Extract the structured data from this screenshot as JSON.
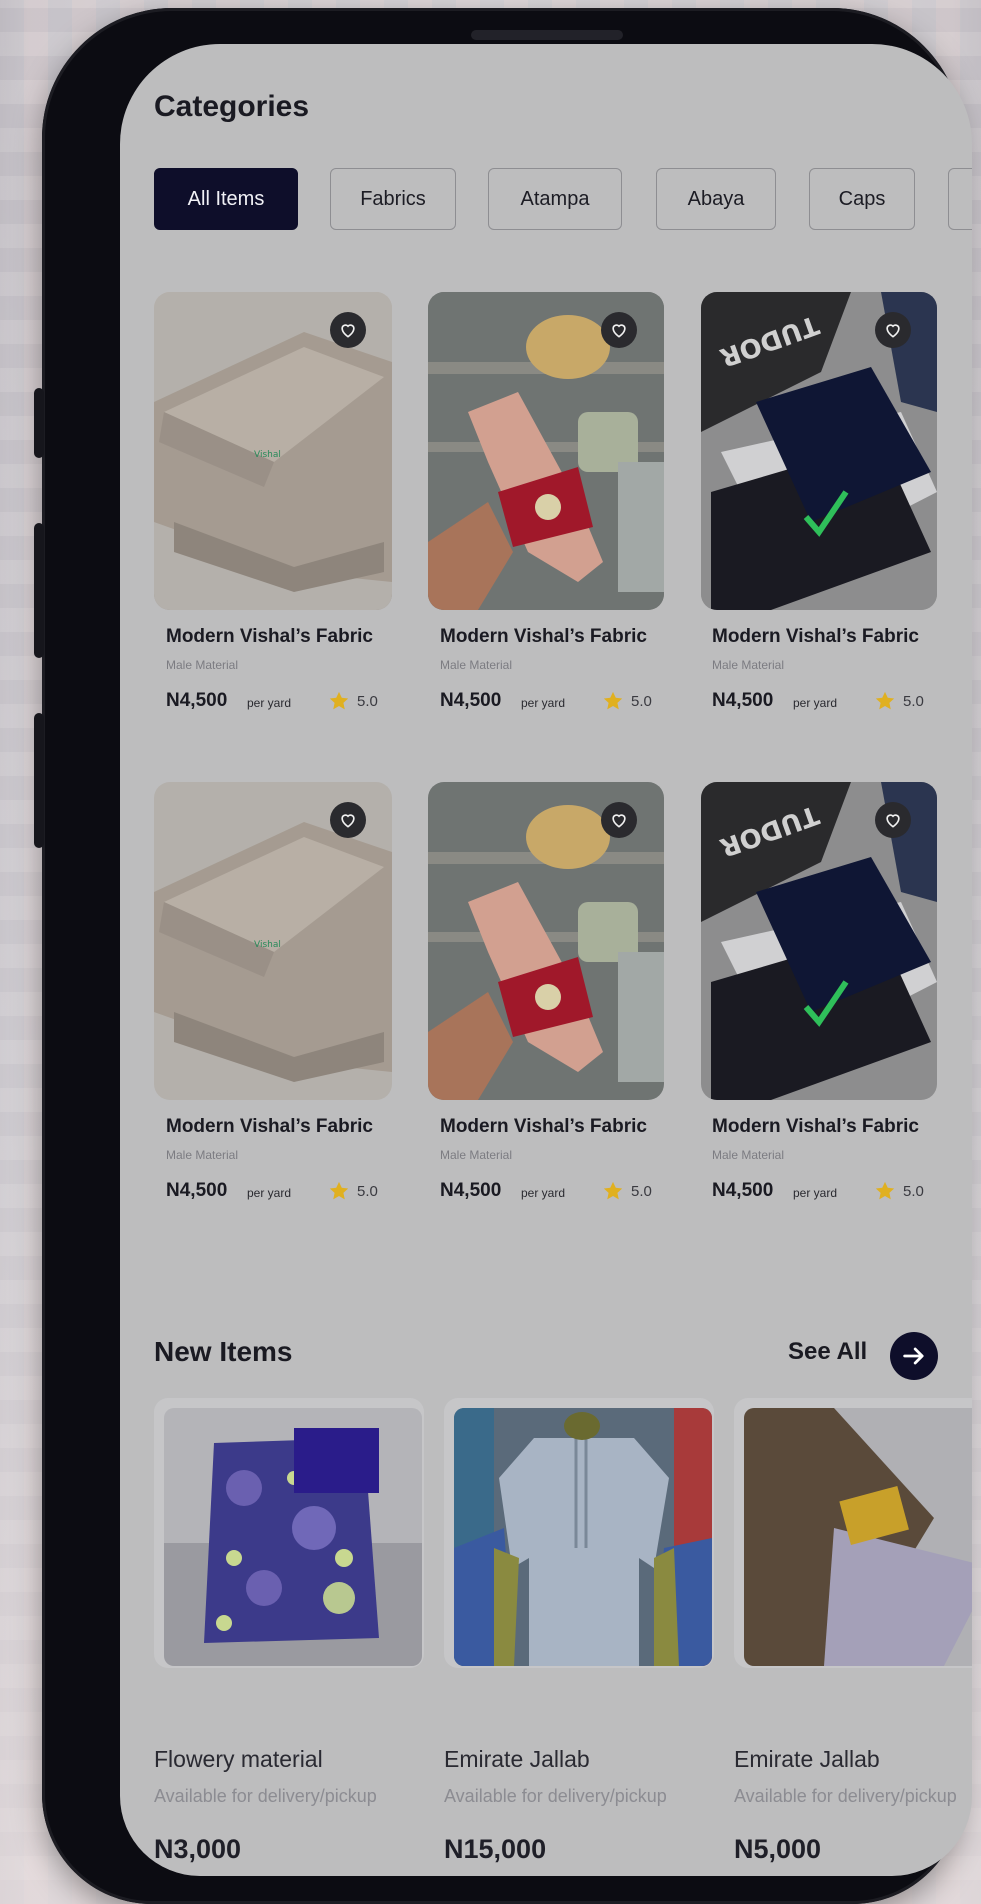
{
  "categories": {
    "title": "Categories",
    "chips": [
      {
        "label": "All Items",
        "active": true
      },
      {
        "label": "Fabrics",
        "active": false
      },
      {
        "label": "Atampa",
        "active": false
      },
      {
        "label": "Abaya",
        "active": false
      },
      {
        "label": "Caps",
        "active": false
      }
    ]
  },
  "products": [
    {
      "name": "Modern Vishal’s Fabric",
      "subtitle": "Male Material",
      "price": "N4,500",
      "unit": "per yard",
      "rating": "5.0",
      "image": "silk-fabric"
    },
    {
      "name": "Modern Vishal’s Fabric",
      "subtitle": "Male Material",
      "price": "N4,500",
      "unit": "per yard",
      "rating": "5.0",
      "image": "sandal"
    },
    {
      "name": "Modern Vishal’s Fabric",
      "subtitle": "Male Material",
      "price": "N4,500",
      "unit": "per yard",
      "rating": "5.0",
      "image": "navy-fabric"
    },
    {
      "name": "Modern Vishal’s Fabric",
      "subtitle": "Male Material",
      "price": "N4,500",
      "unit": "per yard",
      "rating": "5.0",
      "image": "silk-fabric"
    },
    {
      "name": "Modern Vishal’s Fabric",
      "subtitle": "Male Material",
      "price": "N4,500",
      "unit": "per yard",
      "rating": "5.0",
      "image": "sandal"
    },
    {
      "name": "Modern Vishal’s Fabric",
      "subtitle": "Male Material",
      "price": "N4,500",
      "unit": "per yard",
      "rating": "5.0",
      "image": "navy-fabric"
    }
  ],
  "new_items": {
    "title": "New Items",
    "see_all": "See All",
    "items": [
      {
        "name": "Flowery material",
        "subtitle": "Available for delivery/pickup",
        "price": "N3,000",
        "image": "flower-print"
      },
      {
        "name": "Emirate Jallab",
        "subtitle": "Available for delivery/pickup",
        "price": "N15,000",
        "image": "jallab"
      },
      {
        "name": "Emirate Jallab",
        "subtitle": "Available for delivery/pickup",
        "price": "N5,000",
        "image": "brown-fabric"
      }
    ]
  },
  "colors": {
    "accent": "#0e0e2a",
    "star": "#e0b020",
    "screen_bg": "#bdbdbe"
  }
}
